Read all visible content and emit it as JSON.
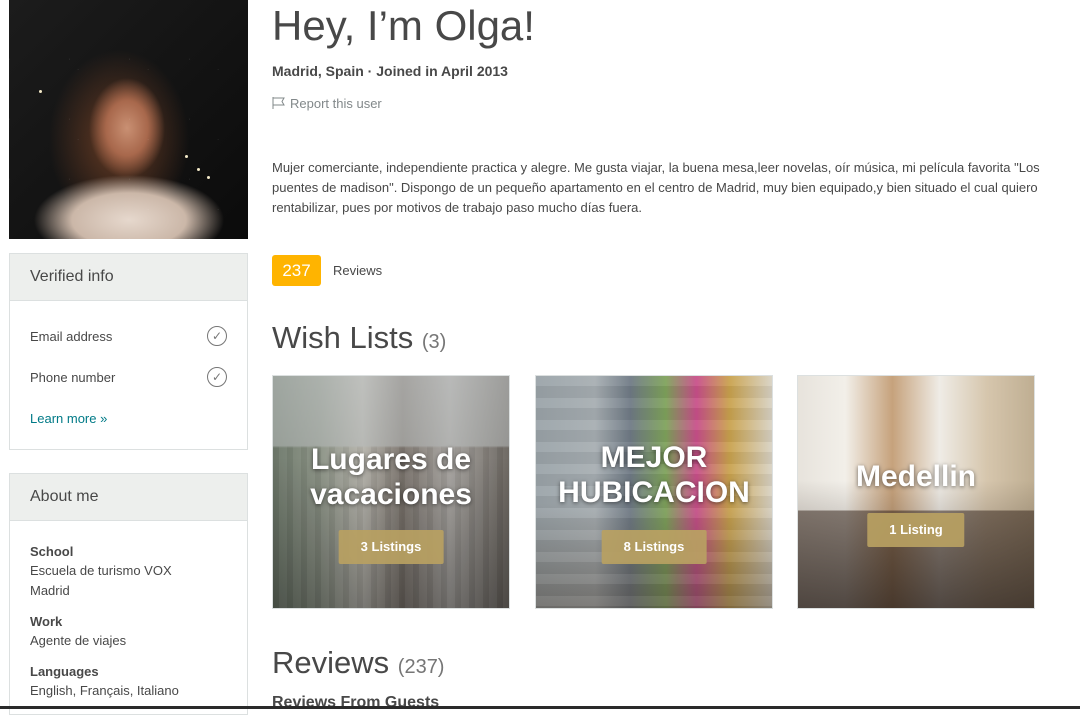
{
  "profile": {
    "greeting": "Hey, I’m Olga!",
    "location_joined": "Madrid, Spain · Joined in April 2013",
    "report_label": "Report this user",
    "bio": "Mujer comerciante, independiente practica y alegre. Me gusta viajar, la buena mesa,leer novelas, oír música, mi película favorita \"Los puentes de madison\". Dispongo de un pequeño apartamento en el centro de Madrid, muy bien equipado,y bien situado el cual quiero rentabilizar, pues por motivos de trabajo paso mucho días fuera."
  },
  "verified": {
    "title": "Verified info",
    "items": [
      {
        "label": "Email address",
        "icon": "check-circle-icon"
      },
      {
        "label": "Phone number",
        "icon": "check-circle-icon"
      }
    ],
    "learn_more": "Learn more »"
  },
  "about": {
    "title": "About me",
    "school_label": "School",
    "school_value_line1": "Escuela de turismo VOX",
    "school_value_line2": "Madrid",
    "work_label": "Work",
    "work_value": "Agente de viajes",
    "languages_label": "Languages",
    "languages_value": "English, Français, Italiano"
  },
  "reviews_badge": {
    "count": "237",
    "label": "Reviews"
  },
  "wish_lists": {
    "title": "Wish Lists",
    "count": "(3)",
    "cards": [
      {
        "title_line1": "Lugares de",
        "title_line2": "vacaciones",
        "listings": "3 Listings"
      },
      {
        "title_line1": "MEJOR",
        "title_line2": "HUBICACION",
        "listings": "8 Listings"
      },
      {
        "title_line1": "Medellin",
        "listings": "1 Listing"
      }
    ]
  },
  "reviews_section": {
    "title": "Reviews",
    "count": "(237)",
    "subheading": "Reviews From Guests"
  },
  "colors": {
    "badge": "#ffb400",
    "link": "#007a87",
    "pill": "#b8a162"
  }
}
